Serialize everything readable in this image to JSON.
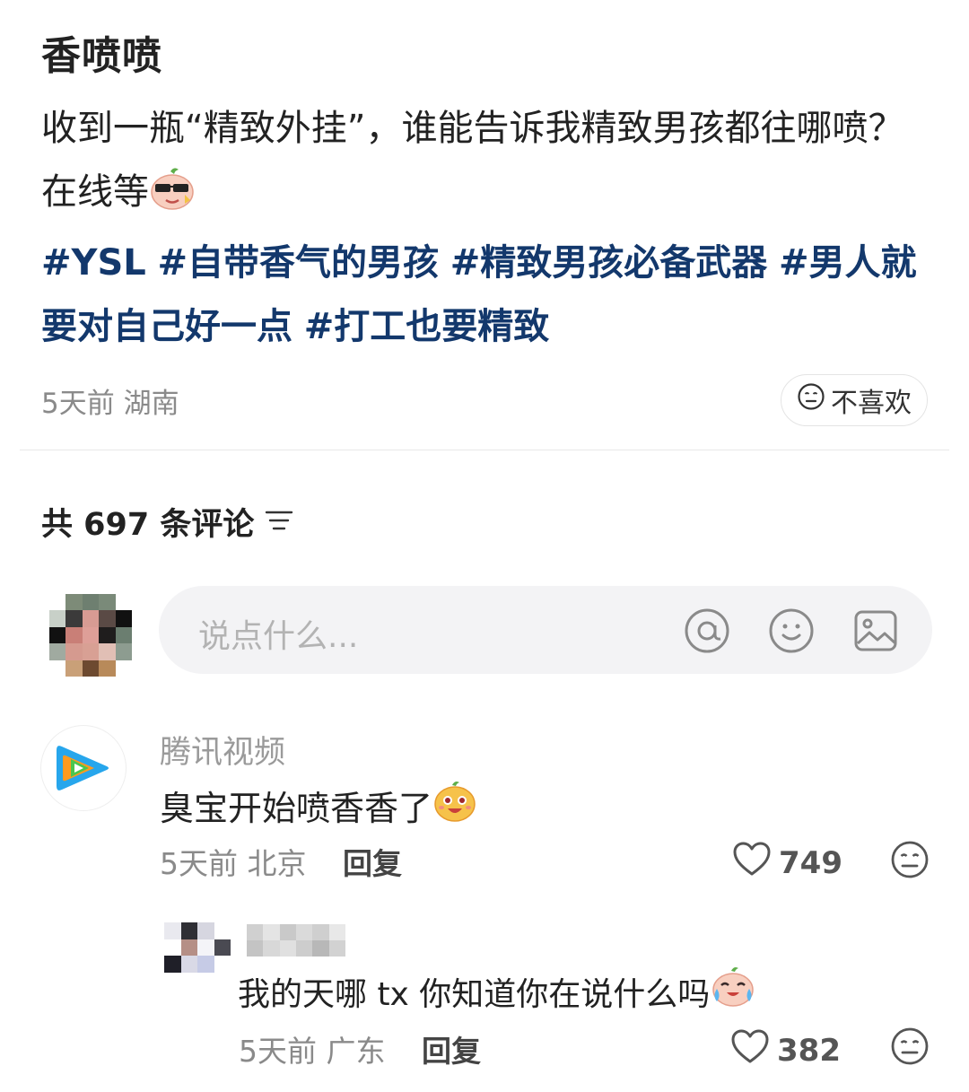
{
  "post": {
    "author": "香喷喷",
    "text_line1": "收到一瓶“精致外挂”，谁能告诉我精致男孩都往哪喷？在线等",
    "hashtags": [
      "#YSL",
      "#自带香气的男孩",
      "#精致男孩必备武器",
      "#男人就要对自己好一点",
      "#打工也要精致"
    ],
    "meta": "5天前 湖南",
    "dislike_label": "不喜欢",
    "emoji": "cool-emoji"
  },
  "comments_header": {
    "label": "共 697 条评论",
    "sort_icon": "sort-icon"
  },
  "composer": {
    "placeholder": "说点什么...",
    "icons": [
      "at-icon",
      "smile-icon",
      "image-icon"
    ]
  },
  "comments": [
    {
      "author": "腾讯视频",
      "text": "臭宝开始喷香香了",
      "emoji": "happy-emoji",
      "meta": "5天前 北京",
      "reply_label": "回复",
      "likes": "749",
      "avatar": "tencent-video-logo"
    }
  ],
  "replies": [
    {
      "text": "我的天哪 tx 你知道你在说什么吗",
      "emoji": "crying-emoji",
      "meta": "5天前 广东",
      "reply_label": "回复",
      "likes": "382"
    }
  ],
  "colors": {
    "hashtag": "#13386c",
    "muted": "#8a8a8a",
    "input_bg": "#f3f3f5"
  }
}
